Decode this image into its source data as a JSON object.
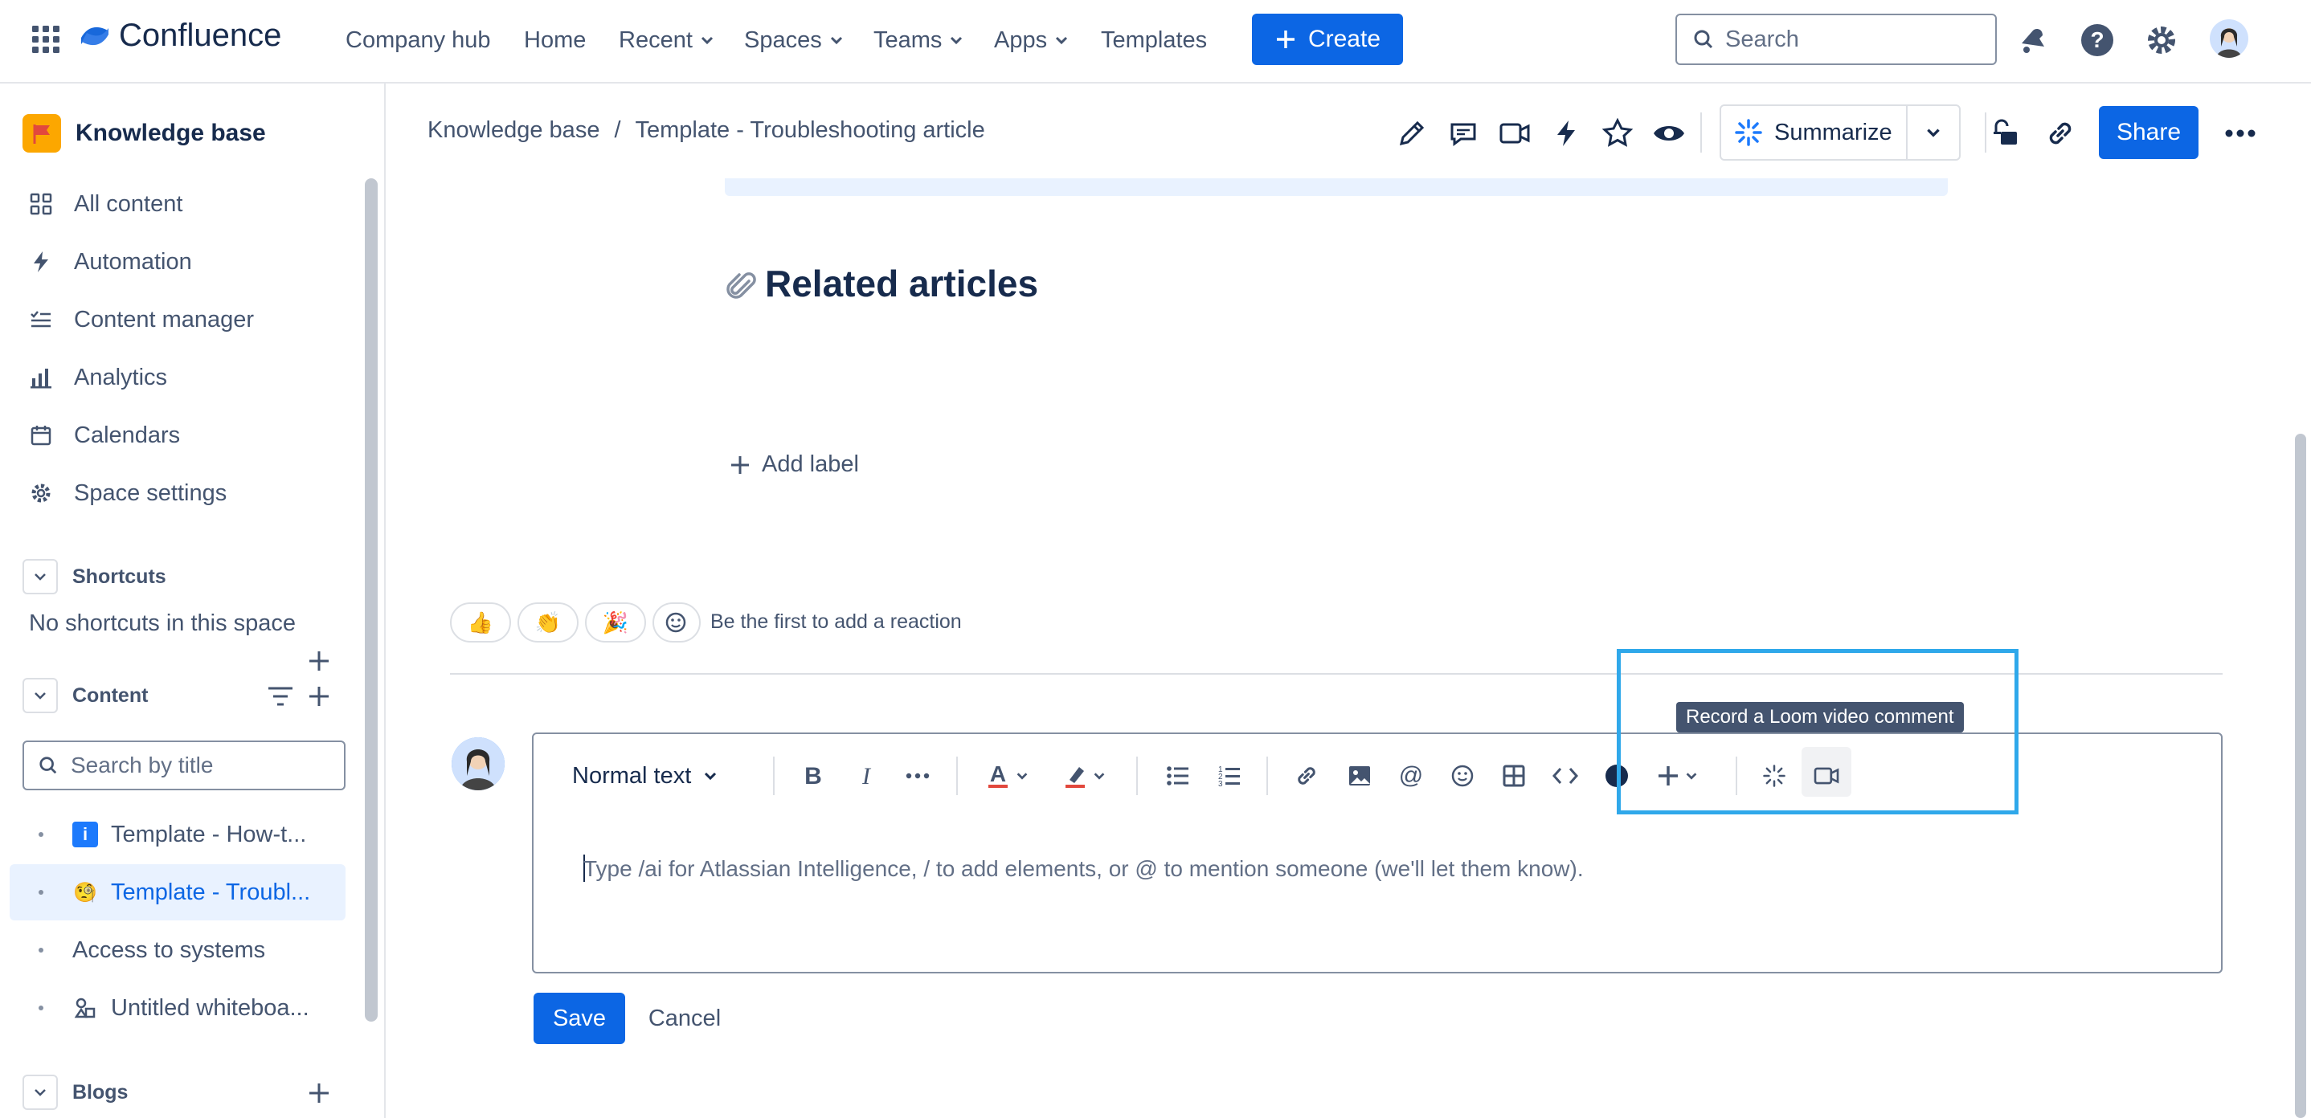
{
  "app": {
    "name": "Confluence"
  },
  "topnav": {
    "links": [
      "Company hub",
      "Home",
      "Recent",
      "Spaces",
      "Teams",
      "Apps",
      "Templates"
    ],
    "create_label": "Create",
    "search_placeholder": "Search"
  },
  "sidebar": {
    "space_name": "Knowledge base",
    "items": [
      "All content",
      "Automation",
      "Content manager",
      "Analytics",
      "Calendars",
      "Space settings"
    ],
    "shortcuts": {
      "title": "Shortcuts",
      "empty_text": "No shortcuts in this space"
    },
    "content": {
      "title": "Content",
      "search_placeholder": "Search by title",
      "tree": [
        "Template - How-t...",
        "Template - Troubl...",
        "Access to systems",
        "Untitled whiteboa..."
      ]
    },
    "blogs_title": "Blogs"
  },
  "header": {
    "breadcrumb": [
      "Knowledge base",
      "/",
      "Template - Troubleshooting article"
    ],
    "summarize_label": "Summarize",
    "share_label": "Share"
  },
  "main": {
    "related_title": "Related articles",
    "add_label": "Add label",
    "reactions": [
      "👍",
      "👏",
      "🎉"
    ],
    "reaction_prompt": "Be the first to add a reaction"
  },
  "editor": {
    "text_style": "Normal text",
    "placeholder": "Type /ai for Atlassian Intelligence, / to add elements, or @ to mention someone (we'll let them know).",
    "tooltip": "Record a Loom video comment",
    "save_label": "Save",
    "cancel_label": "Cancel"
  },
  "colors": {
    "brand_blue": "#0c66e4",
    "highlight_box": "#2fa8ea",
    "selected_bg": "#e9f2ff"
  }
}
